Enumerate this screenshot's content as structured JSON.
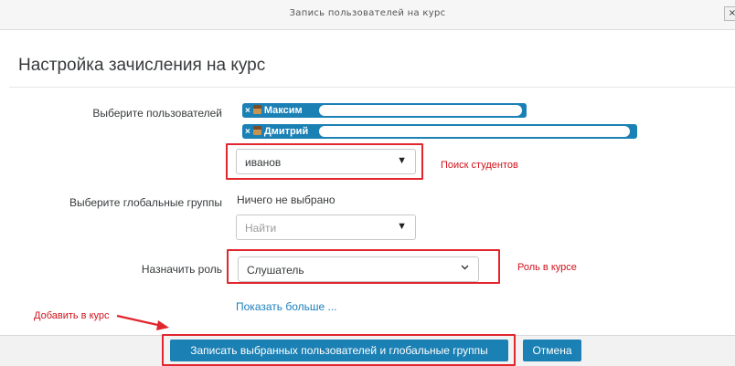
{
  "dialog": {
    "title": "Запись пользователей на курс",
    "close_label": "×",
    "heading": "Настройка зачисления на курс"
  },
  "form": {
    "select_users_label": "Выберите пользователей",
    "selected_users": [
      {
        "name": "Максим"
      },
      {
        "name": "Дмитрий"
      }
    ],
    "remove_glyph": "×",
    "user_search_value": "иванов",
    "global_groups_label": "Выберите глобальные группы",
    "global_groups_status": "Ничего не выбрано",
    "global_groups_placeholder": "Найти",
    "assign_role_label": "Назначить роль",
    "role_value": "Слушатель",
    "show_more_link": "Показать больше ...",
    "dropdown_arrow": "▼"
  },
  "annotations": {
    "search_students": "Поиск студентов",
    "role_in_course": "Роль в курсе",
    "add_to_course": "Добавить в курс"
  },
  "footer": {
    "submit_label": "Записать выбранных пользователей и глобальные группы",
    "cancel_label": "Отмена"
  },
  "colors": {
    "accent": "#1b80b4",
    "annotation_red": "#e1262d",
    "link": "#1b7fbb"
  }
}
